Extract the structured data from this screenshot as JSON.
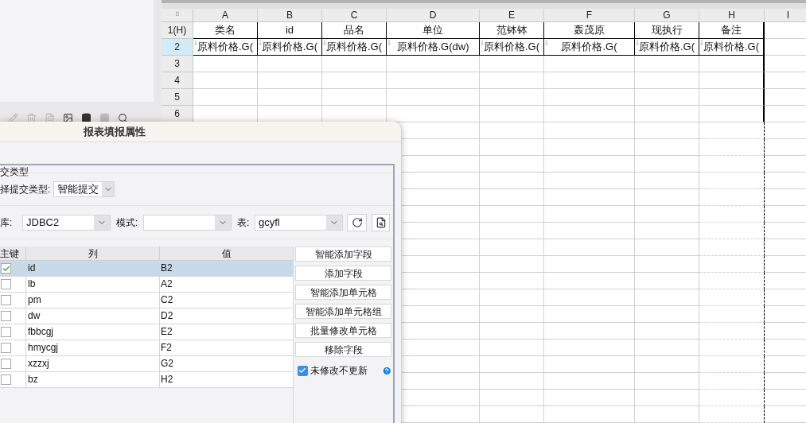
{
  "sheet": {
    "corner": "⠿",
    "columns": [
      "A",
      "B",
      "C",
      "D",
      "E",
      "F",
      "G",
      "H",
      "I"
    ],
    "rows": [
      {
        "label": "1(H)",
        "kind": "header",
        "selected": false,
        "cells": [
          "类名",
          "id",
          "品名",
          "单位",
          "范钵钵",
          "轰茂原",
          "现执行",
          "备注"
        ]
      },
      {
        "label": "2",
        "kind": "data",
        "selected": true,
        "cells": [
          "原料价格.G(",
          "原料价格.G(",
          "原料价格.G(",
          "原料价格.G(dw)",
          "原料价格.G(",
          "原料价格.G(",
          "原料价格.G(",
          "原料价格.G("
        ]
      },
      {
        "label": "3",
        "kind": "empty",
        "selected": false,
        "cells": []
      },
      {
        "label": "4",
        "kind": "empty",
        "selected": false,
        "cells": []
      },
      {
        "label": "5",
        "kind": "empty",
        "selected": false,
        "cells": []
      },
      {
        "label": "6",
        "kind": "empty",
        "selected": false,
        "cells": []
      }
    ]
  },
  "dialog": {
    "title": "报表填报属性",
    "group_label": "交类型",
    "submit_type": {
      "label": "择提交类型:",
      "value": "智能提交"
    },
    "source": {
      "db_label": "库:",
      "db_value": "JDBC2",
      "mode_label": "模式:",
      "table_label": "表:",
      "table_value": "gcyfl"
    },
    "fields": {
      "columns": [
        "主键",
        "列",
        "值"
      ],
      "rows": [
        {
          "key": true,
          "selected": true,
          "column": "id",
          "value": "B2"
        },
        {
          "key": false,
          "selected": false,
          "column": "lb",
          "value": "A2"
        },
        {
          "key": false,
          "selected": false,
          "column": "pm",
          "value": "C2"
        },
        {
          "key": false,
          "selected": false,
          "column": "dw",
          "value": "D2"
        },
        {
          "key": false,
          "selected": false,
          "column": "fbbcgj",
          "value": "E2"
        },
        {
          "key": false,
          "selected": false,
          "column": "hmycgj",
          "value": "F2"
        },
        {
          "key": false,
          "selected": false,
          "column": "xzzxj",
          "value": "G2"
        },
        {
          "key": false,
          "selected": false,
          "column": "bz",
          "value": "H2"
        }
      ]
    },
    "buttons": [
      "智能添加字段",
      "添加字段",
      "智能添加单元格",
      "智能添加单元格组",
      "批量修改单元格",
      "移除字段"
    ],
    "option": {
      "label": "未修改不更新",
      "checked": true
    }
  }
}
